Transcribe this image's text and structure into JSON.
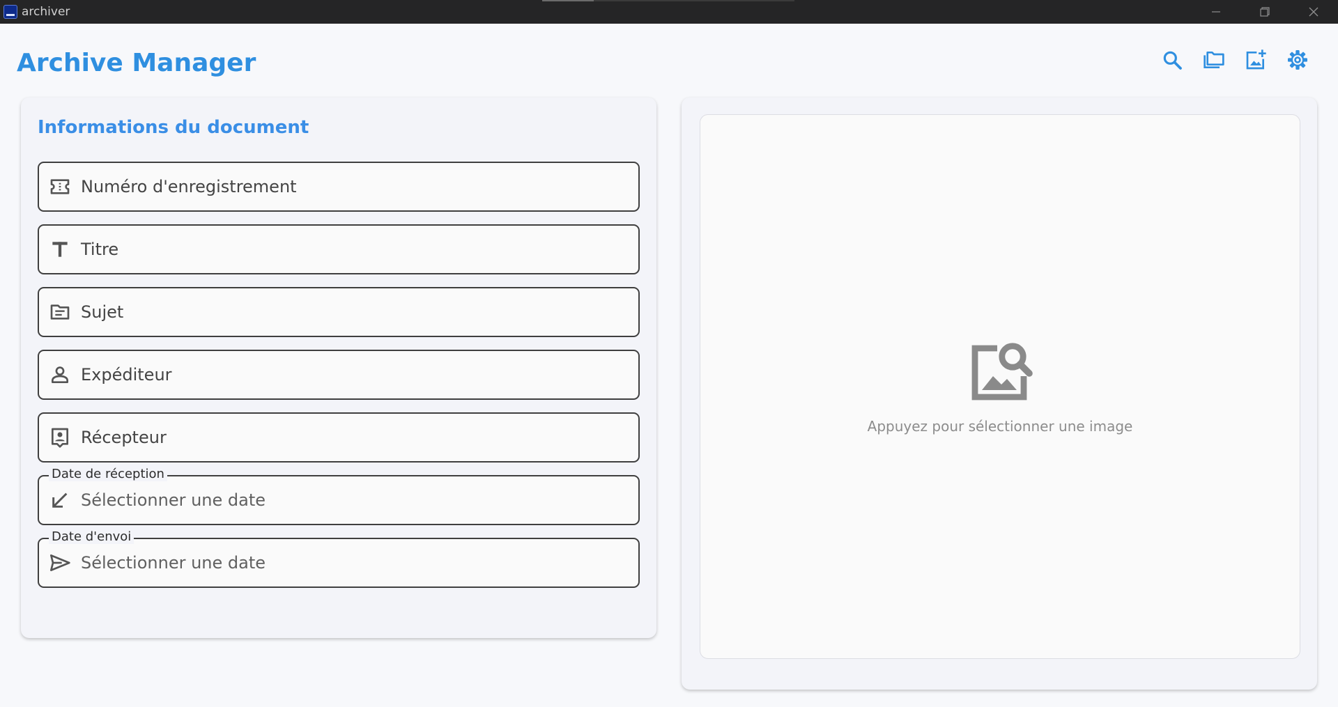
{
  "window": {
    "title": "archiver",
    "controls": [
      "minimize",
      "restore",
      "close"
    ]
  },
  "header": {
    "title": "Archive Manager",
    "toolbar": [
      {
        "name": "search-icon"
      },
      {
        "name": "folders-icon"
      },
      {
        "name": "add-photo-icon"
      },
      {
        "name": "settings-icon"
      }
    ],
    "accent": "#2f8fe0"
  },
  "form": {
    "title": "Informations du document",
    "fields": [
      {
        "label": "Numéro d'enregistrement",
        "icon": "ticket-icon"
      },
      {
        "label": "Titre",
        "icon": "text-title-icon"
      },
      {
        "label": "Sujet",
        "icon": "subject-folder-icon"
      },
      {
        "label": "Expéditeur",
        "icon": "person-icon"
      },
      {
        "label": "Récepteur",
        "icon": "contact-badge-icon"
      },
      {
        "legend": "Date de réception",
        "placeholder": "Sélectionner une date",
        "icon": "arrow-down-left-icon"
      },
      {
        "legend": "Date d'envoi",
        "placeholder": "Sélectionner une date",
        "icon": "send-icon"
      }
    ]
  },
  "image_panel": {
    "prompt": "Appuyez pour sélectionner une image",
    "icon": "image-search-icon"
  }
}
